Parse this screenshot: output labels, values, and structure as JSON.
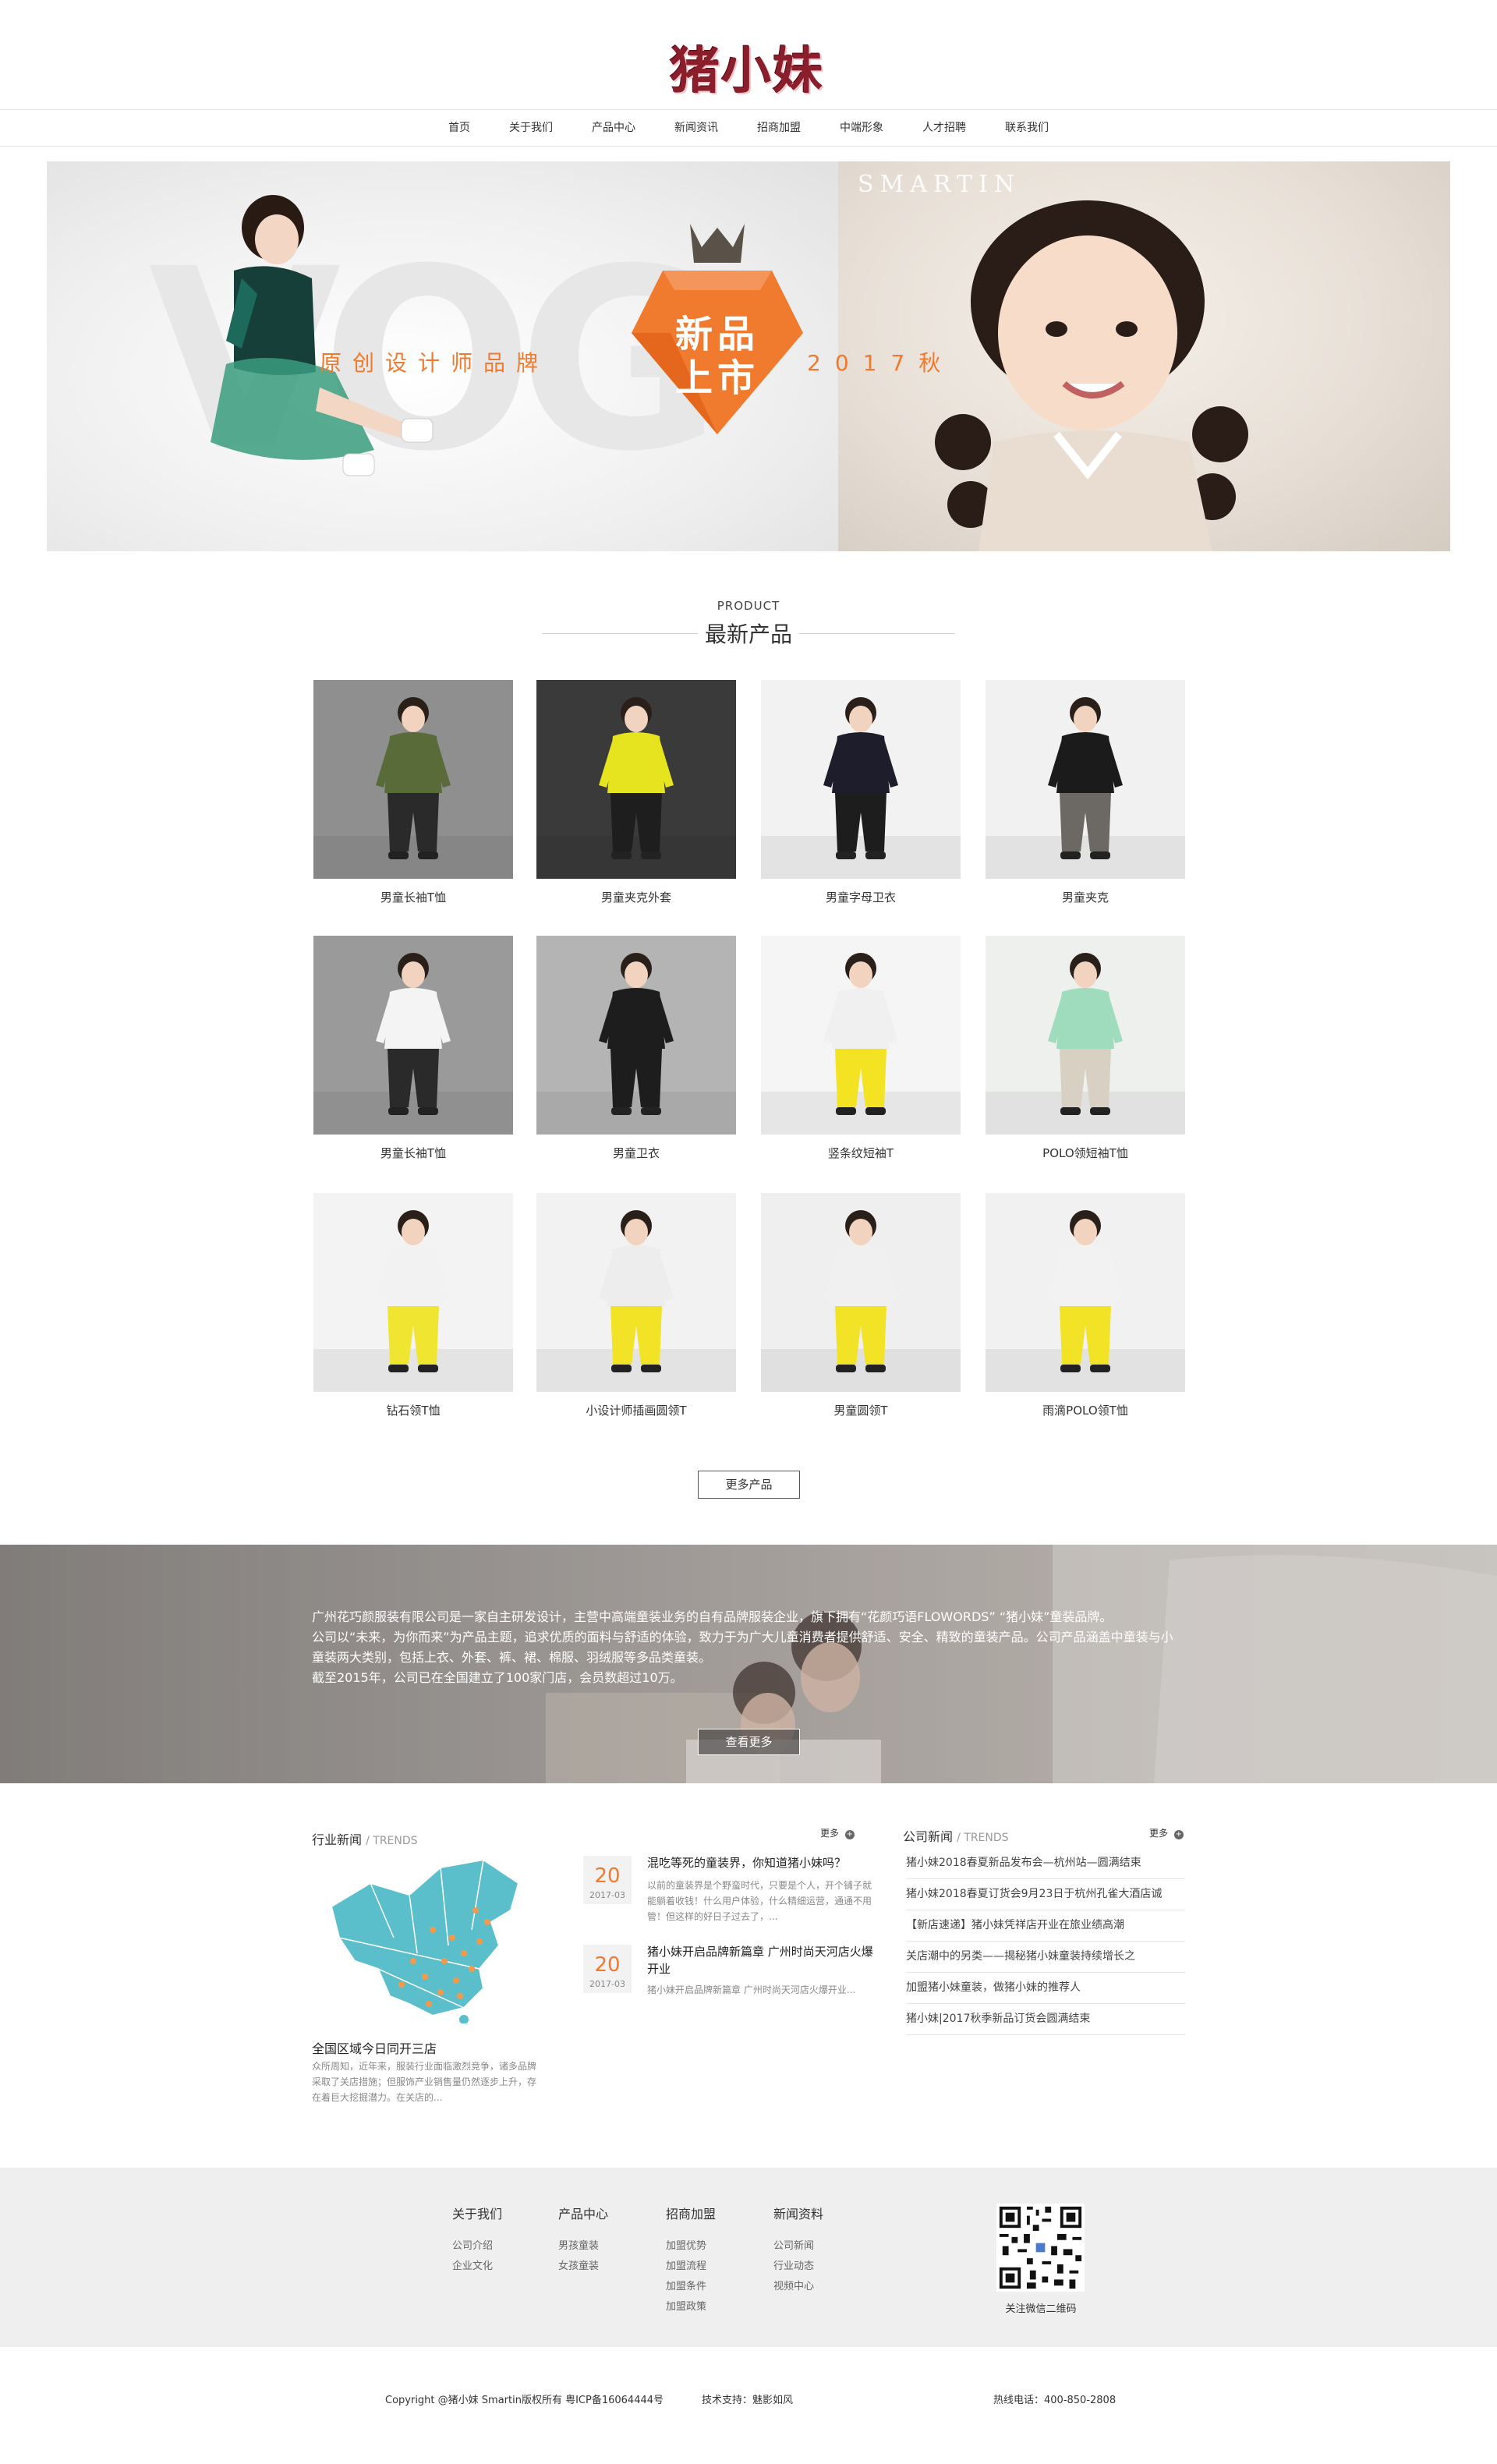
{
  "brand": {
    "logo_text": "猪小妹"
  },
  "nav": [
    "首页",
    "关于我们",
    "产品中心",
    "新闻资讯",
    "招商加盟",
    "中端形象",
    "人才招聘",
    "联系我们"
  ],
  "banner": {
    "watermark": "SMARTIN",
    "slogan_left": "原创设计师品牌",
    "slogan_right": "2017秋",
    "badge_line1": "新品",
    "badge_line2": "上市"
  },
  "products": {
    "heading_en": "PRODUCT",
    "heading_cn": "最新产品",
    "items": [
      {
        "name": "男童长袖T恤"
      },
      {
        "name": "男童夹克外套"
      },
      {
        "name": "男童字母卫衣"
      },
      {
        "name": "男童夹克"
      },
      {
        "name": "男童长袖T恤"
      },
      {
        "name": "男童卫衣"
      },
      {
        "name": "竖条纹短袖T"
      },
      {
        "name": "POLO领短袖T恤"
      },
      {
        "name": "钻石领T恤"
      },
      {
        "name": "小设计师插画圆领T"
      },
      {
        "name": "男童圆领T"
      },
      {
        "name": "雨滴POLO领T恤"
      }
    ],
    "more_label": "更多产品"
  },
  "about": {
    "paragraph1": "广州花巧颜服装有限公司是一家自主研发设计，主营中高端童装业务的自有品牌服装企业，旗下拥有“花颜巧语FLOWORDS” “猪小妹”童装品牌。",
    "paragraph2": "公司以“未来，为你而来”为产品主题，追求优质的面料与舒适的体验，致力于为广大儿童消费者提供舒适、安全、精致的童装产品。公司产品涵盖中童装与小童装两大类别，包括上衣、外套、裤、裙、棉服、羽绒服等多品类童装。",
    "paragraph3": "截至2015年，公司已在全国建立了100家门店，会员数超过10万。",
    "more_label": "查看更多"
  },
  "news": {
    "industry": {
      "title": "行业新闻",
      "title_en": "TRENDS",
      "map_caption": "全国区域今日同开三店",
      "map_desc": "众所周知，近年来，服装行业面临激烈竞争，诸多品牌采取了关店措施；但服饰产业销售量仍然逐步上升，存在着巨大挖掘潜力。在关店的..."
    },
    "middle": {
      "more_label": "更多",
      "items": [
        {
          "day": "20",
          "ym": "2017-03",
          "title": "混吃等死的童装界，你知道猪小妹吗？",
          "desc": "以前的童装界是个野蛮时代，只要是个人，开个铺子就能躺着收钱！什么用户体验，什么精细运营，通通不用管！但这样的好日子过去了，..."
        },
        {
          "day": "20",
          "ym": "2017-03",
          "title": "猪小妹开启品牌新篇章 广州时尚天河店火爆开业",
          "desc": "猪小妹开启品牌新篇章 广州时尚天河店火爆开业..."
        }
      ]
    },
    "company": {
      "title": "公司新闻",
      "title_en": "TRENDS",
      "more_label": "更多",
      "items": [
        "猪小妹2018春夏新品发布会—杭州站—圆满结束",
        "猪小妹2018春夏订货会9月23日于杭州孔雀大酒店诚",
        "【新店速递】猪小妹凭祥店开业在旅业绩高潮",
        "关店潮中的另类——揭秘猪小妹童装持续增长之",
        "加盟猪小妹童装，做猪小妹的推荐人",
        "猪小妹|2017秋季新品订货会圆满结束"
      ]
    }
  },
  "footer": {
    "columns": [
      {
        "title": "关于我们",
        "links": [
          "公司介绍",
          "企业文化"
        ]
      },
      {
        "title": "产品中心",
        "links": [
          "男孩童装",
          "女孩童装"
        ]
      },
      {
        "title": "招商加盟",
        "links": [
          "加盟优势",
          "加盟流程",
          "加盟条件",
          "加盟政策"
        ]
      },
      {
        "title": "新闻资料",
        "links": [
          "公司新闻",
          "行业动态",
          "视频中心"
        ]
      }
    ],
    "qr_label": "关注微信二维码",
    "copyright": "Copyright @猪小妹 Smartin版权所有   粤ICP备16064444号",
    "tech_support": "技术支持：魅影如风",
    "hotline": "热线电话：400-850-2808"
  },
  "colors": {
    "accent": "#f07a2e",
    "logo": "#8a1f2b",
    "map": "#5bbfcb",
    "footer_bg": "#efefef"
  }
}
